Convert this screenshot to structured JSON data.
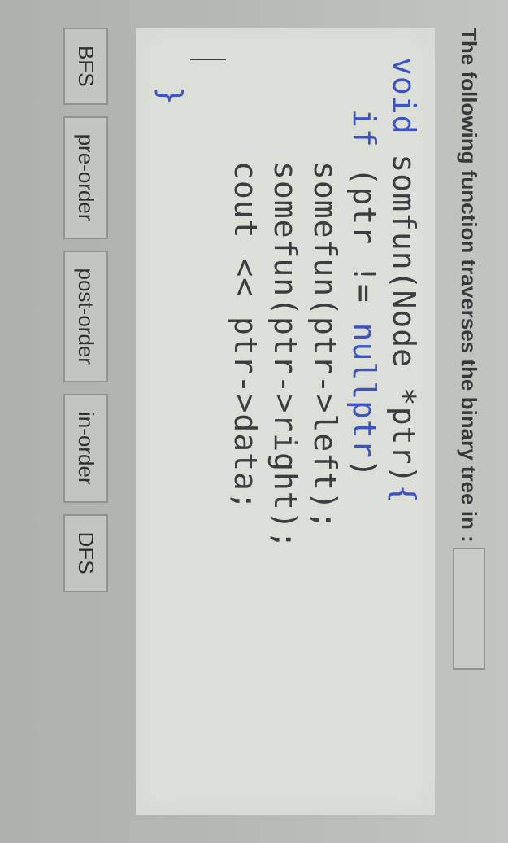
{
  "question": {
    "prompt": "The following function traverses the binary tree in :"
  },
  "code": {
    "l1_kw": "void",
    "l1_rest": " somfun(Node *ptr)",
    "l1_brace": "{",
    "l2_kw": "if",
    "l2_mid": " (ptr != ",
    "l2_null": "nullptr",
    "l2_end": ")",
    "l3": "somefun(ptr->left);",
    "l4": "somefun(ptr->right);",
    "l5": "cout << ptr->data;",
    "l6_brace": "}"
  },
  "options": [
    "BFS",
    "pre-order",
    "post-order",
    "in-order",
    "DFS"
  ]
}
